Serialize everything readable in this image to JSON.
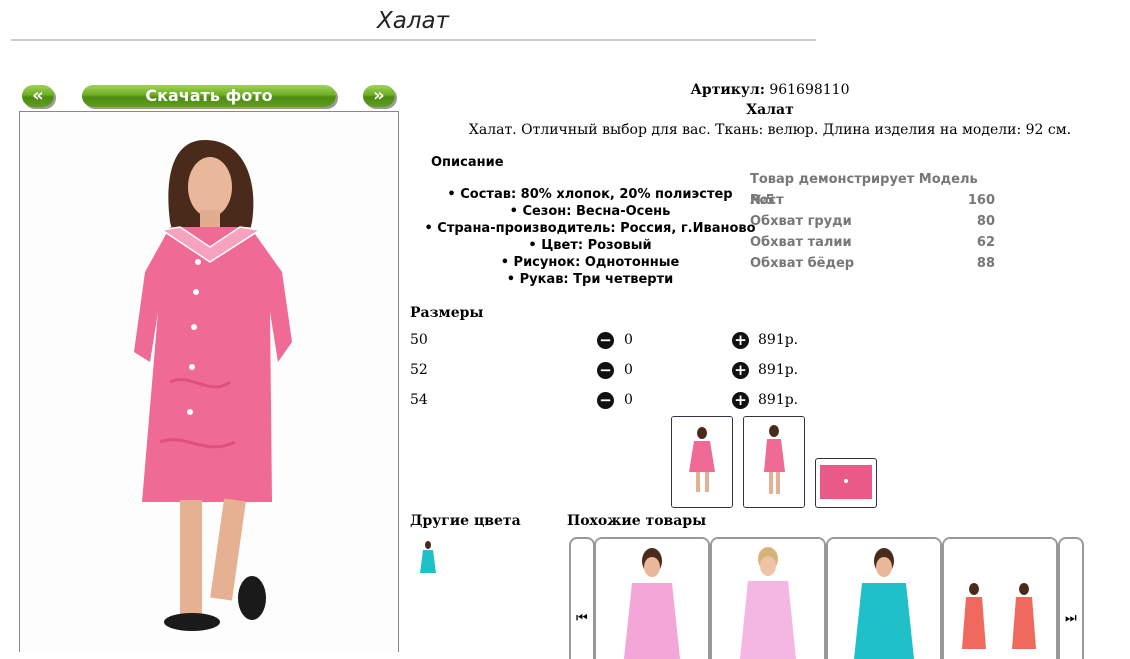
{
  "page": {
    "title": "Халат"
  },
  "nav": {
    "prev_label": "«",
    "download_label": "Скачать фото",
    "next_label": "»"
  },
  "product": {
    "article_label": "Артикул:",
    "article_value": "961698110",
    "name": "Халат",
    "description": "Халат. Отличный выбор для вас. Ткань: велюр. Длина изделия на модели: 92 см."
  },
  "description_section": {
    "heading": "Описание",
    "features": [
      "Состав: 80% хлопок, 20% полиэстер",
      "Сезон: Весна-Осень",
      "Страна-производитель: Россия, г.Иваново",
      "Цвет: Розовый",
      "Рисунок: Однотонные",
      "Рукав: Три четверти"
    ]
  },
  "model": {
    "heading": "Товар демонстрирует Модель №5",
    "rows": [
      {
        "label": "Рост",
        "value": "160"
      },
      {
        "label": "Обхват груди",
        "value": "80"
      },
      {
        "label": "Обхват талии",
        "value": "62"
      },
      {
        "label": "Обхват бёдер",
        "value": "88"
      }
    ]
  },
  "sizes": {
    "heading": "Размеры",
    "rows": [
      {
        "size": "50",
        "qty": "0",
        "price": "891р."
      },
      {
        "size": "52",
        "qty": "0",
        "price": "891р."
      },
      {
        "size": "54",
        "qty": "0",
        "price": "891р."
      }
    ]
  },
  "other_colors": {
    "heading": "Другие цвета"
  },
  "similar": {
    "heading": "Похожие товары"
  },
  "colors": {
    "pink": "#f06a96",
    "turquoise": "#1fc0c8",
    "green": "#6fae24"
  }
}
